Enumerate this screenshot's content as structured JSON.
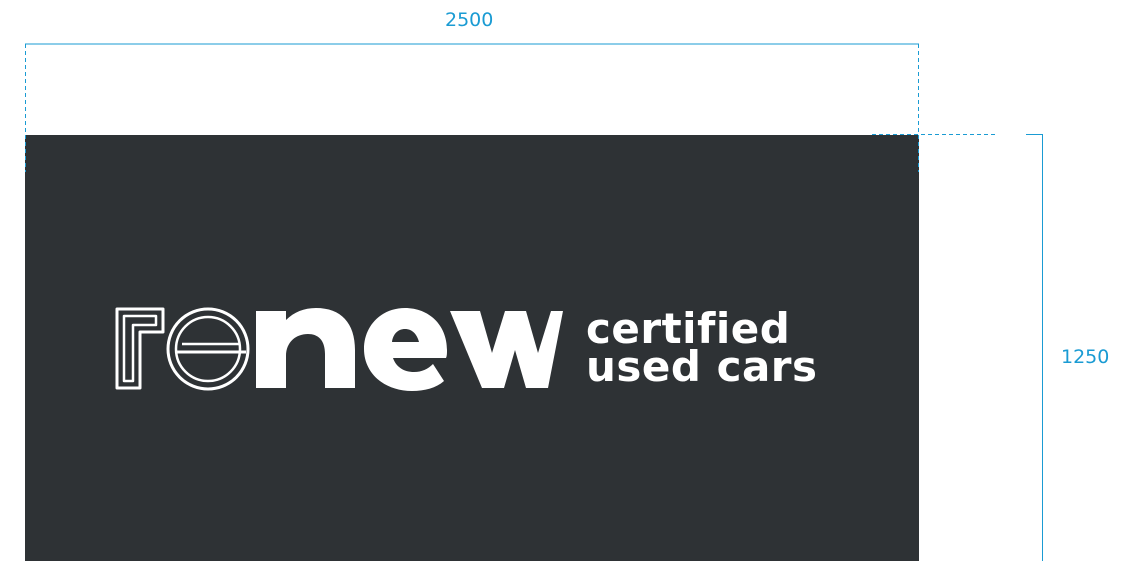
{
  "dimensions": {
    "width_label": "2500",
    "height_label": "1250"
  },
  "banner": {
    "background_color": "#2e3235",
    "accent_color": "#1a9bd3",
    "logo": {
      "outline_text": "re",
      "solid_text": "new"
    },
    "tagline": {
      "line1": "certified",
      "line2": "used cars"
    }
  }
}
